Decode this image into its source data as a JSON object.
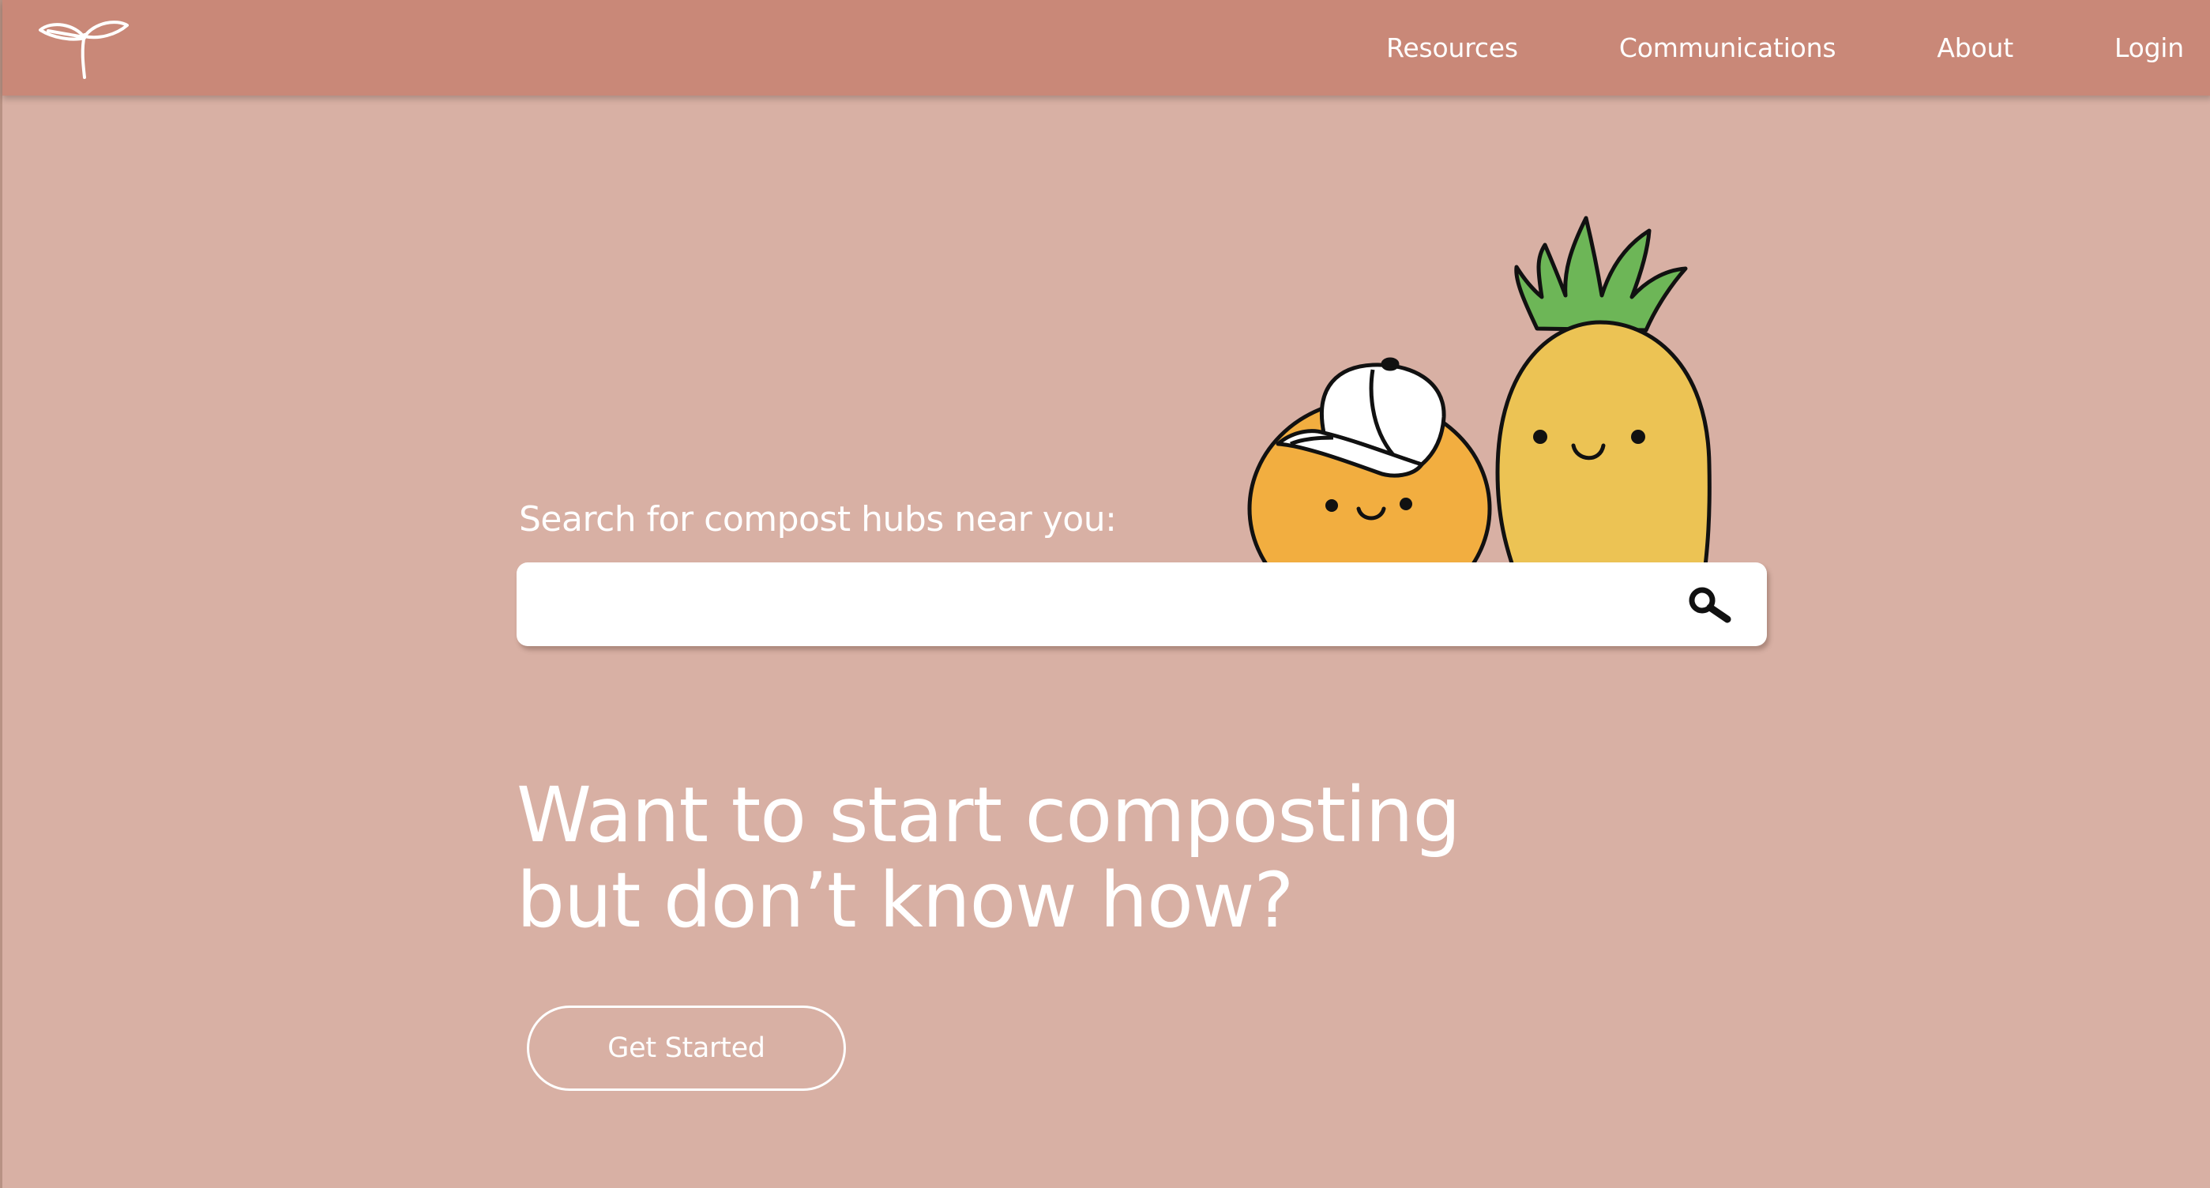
{
  "nav": {
    "logo_icon": "sprout-icon",
    "links": [
      {
        "label": "Resources"
      },
      {
        "label": "Communications"
      },
      {
        "label": "About"
      },
      {
        "label": "Login"
      }
    ]
  },
  "hero": {
    "illustration": [
      "orange-with-cap",
      "pineapple"
    ],
    "search": {
      "label": "Search for compost hubs near you:",
      "placeholder": "",
      "value": "",
      "icon": "search-icon"
    },
    "headline": {
      "line1": "Want to start composting",
      "line2": "but don’t know how?"
    },
    "cta_label": "Get Started"
  },
  "colors": {
    "navbar": "#c98878",
    "background": "#d8b0a4",
    "text": "#ffffff",
    "orange": "#f2ae40",
    "pineapple": "#ecc354",
    "leaves": "#6db657"
  }
}
